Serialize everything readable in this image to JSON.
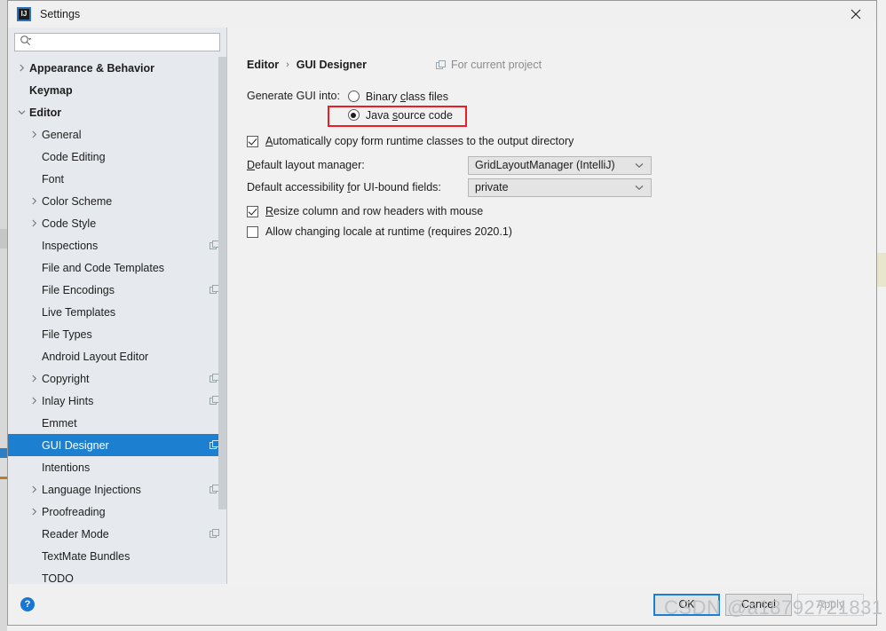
{
  "window": {
    "title": "Settings",
    "app_icon": "intellij-logo-icon",
    "close_icon": "close-icon"
  },
  "search": {
    "placeholder": "",
    "value": "",
    "icon": "search-icon"
  },
  "sidebar": {
    "items": [
      {
        "label": "Appearance & Behavior",
        "level": 0,
        "bold": true,
        "arrow": "chevron-right",
        "module_icon": false,
        "selected": false
      },
      {
        "label": "Keymap",
        "level": 0,
        "bold": true,
        "arrow": "none",
        "module_icon": false,
        "selected": false
      },
      {
        "label": "Editor",
        "level": 0,
        "bold": true,
        "arrow": "chevron-down",
        "module_icon": false,
        "selected": false
      },
      {
        "label": "General",
        "level": 1,
        "bold": false,
        "arrow": "chevron-right",
        "module_icon": false,
        "selected": false
      },
      {
        "label": "Code Editing",
        "level": 1,
        "bold": false,
        "arrow": "none",
        "module_icon": false,
        "selected": false
      },
      {
        "label": "Font",
        "level": 1,
        "bold": false,
        "arrow": "none",
        "module_icon": false,
        "selected": false
      },
      {
        "label": "Color Scheme",
        "level": 1,
        "bold": false,
        "arrow": "chevron-right",
        "module_icon": false,
        "selected": false
      },
      {
        "label": "Code Style",
        "level": 1,
        "bold": false,
        "arrow": "chevron-right",
        "module_icon": false,
        "selected": false
      },
      {
        "label": "Inspections",
        "level": 1,
        "bold": false,
        "arrow": "none",
        "module_icon": true,
        "selected": false
      },
      {
        "label": "File and Code Templates",
        "level": 1,
        "bold": false,
        "arrow": "none",
        "module_icon": false,
        "selected": false
      },
      {
        "label": "File Encodings",
        "level": 1,
        "bold": false,
        "arrow": "none",
        "module_icon": true,
        "selected": false
      },
      {
        "label": "Live Templates",
        "level": 1,
        "bold": false,
        "arrow": "none",
        "module_icon": false,
        "selected": false
      },
      {
        "label": "File Types",
        "level": 1,
        "bold": false,
        "arrow": "none",
        "module_icon": false,
        "selected": false
      },
      {
        "label": "Android Layout Editor",
        "level": 1,
        "bold": false,
        "arrow": "none",
        "module_icon": false,
        "selected": false
      },
      {
        "label": "Copyright",
        "level": 1,
        "bold": false,
        "arrow": "chevron-right",
        "module_icon": true,
        "selected": false
      },
      {
        "label": "Inlay Hints",
        "level": 1,
        "bold": false,
        "arrow": "chevron-right",
        "module_icon": true,
        "selected": false
      },
      {
        "label": "Emmet",
        "level": 1,
        "bold": false,
        "arrow": "none",
        "module_icon": false,
        "selected": false
      },
      {
        "label": "GUI Designer",
        "level": 1,
        "bold": false,
        "arrow": "none",
        "module_icon": true,
        "selected": true
      },
      {
        "label": "Intentions",
        "level": 1,
        "bold": false,
        "arrow": "none",
        "module_icon": false,
        "selected": false
      },
      {
        "label": "Language Injections",
        "level": 1,
        "bold": false,
        "arrow": "chevron-right",
        "module_icon": true,
        "selected": false
      },
      {
        "label": "Proofreading",
        "level": 1,
        "bold": false,
        "arrow": "chevron-right",
        "module_icon": false,
        "selected": false
      },
      {
        "label": "Reader Mode",
        "level": 1,
        "bold": false,
        "arrow": "none",
        "module_icon": true,
        "selected": false
      },
      {
        "label": "TextMate Bundles",
        "level": 1,
        "bold": false,
        "arrow": "none",
        "module_icon": false,
        "selected": false
      },
      {
        "label": "TODO",
        "level": 1,
        "bold": false,
        "arrow": "none",
        "module_icon": false,
        "selected": false
      }
    ]
  },
  "main": {
    "breadcrumb": {
      "parent": "Editor",
      "separator": "›",
      "current": "GUI Designer"
    },
    "scope": {
      "label": "For current project",
      "icon": "module-icon"
    },
    "generate": {
      "label": "Generate GUI into:",
      "options": [
        {
          "label": "Binary class files",
          "accel": "c",
          "selected": false,
          "highlighted": false
        },
        {
          "label": "Java source code",
          "accel": "s",
          "selected": true,
          "highlighted": true
        }
      ],
      "highlight_color": "#ee1c25"
    },
    "auto_copy": {
      "label": "Automatically copy form runtime classes to the output directory",
      "accel": "A",
      "checked": true
    },
    "layout_manager": {
      "label": "Default layout manager:",
      "accel": "D",
      "value": "GridLayoutManager (IntelliJ)"
    },
    "accessibility": {
      "label": "Default accessibility for UI-bound fields:",
      "accel": "f",
      "value": "private"
    },
    "resize_headers": {
      "label": "Resize column and row headers with mouse",
      "accel": "R",
      "checked": true
    },
    "allow_locale": {
      "label": "Allow changing locale at runtime (requires 2020.1)",
      "checked": false
    }
  },
  "footer": {
    "help_label": "?",
    "buttons": [
      {
        "label": "OK",
        "state": "default"
      },
      {
        "label": "Cancel",
        "state": "normal"
      },
      {
        "label": "Apply",
        "state": "disabled"
      }
    ]
  },
  "watermark": {
    "text": "CSDN @a18792721831"
  }
}
